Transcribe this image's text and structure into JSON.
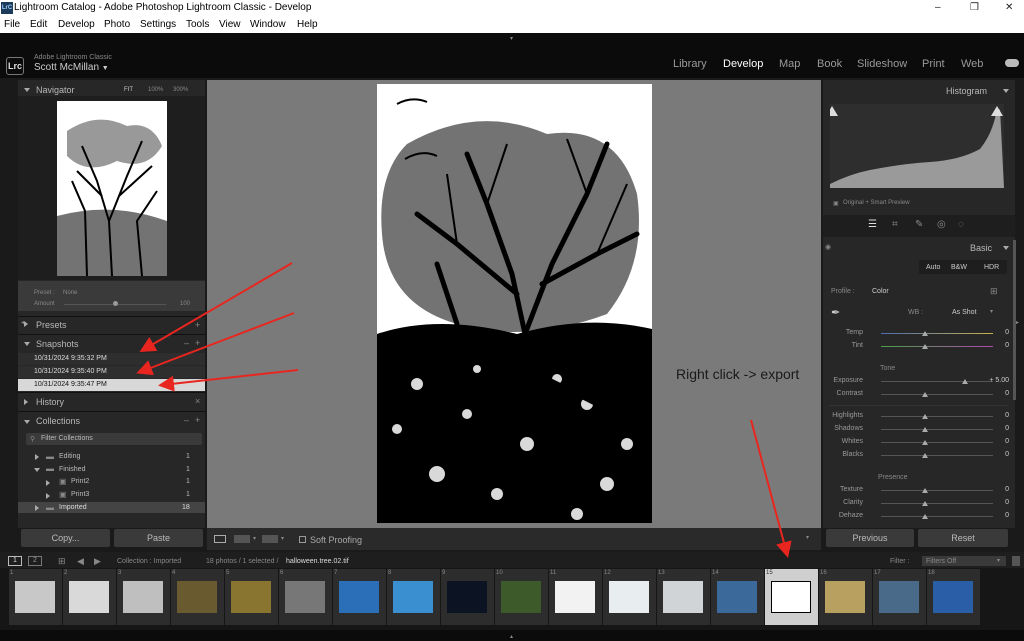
{
  "window": {
    "title": "Lightroom Catalog - Adobe Photoshop Lightroom Classic - Develop",
    "minimize": "–",
    "restore": "❐",
    "close": "✕"
  },
  "menu": [
    "File",
    "Edit",
    "Develop",
    "Photo",
    "Settings",
    "Tools",
    "View",
    "Window",
    "Help"
  ],
  "identity": {
    "badge": "Lrc",
    "product": "Adobe Lightroom Classic",
    "user": "Scott McMillan",
    "user_caret": "▼"
  },
  "modules": [
    "Library",
    "Develop",
    "Map",
    "Book",
    "Slideshow",
    "Print",
    "Web"
  ],
  "active_module": "Develop",
  "left": {
    "navigator": {
      "title": "Navigator",
      "zooms": [
        "FIT",
        "100%",
        "300%"
      ]
    },
    "preset": {
      "label": "Preset :",
      "value": "None",
      "amount_label": "Amount",
      "amount_value": "100"
    },
    "presets_title": "Presets",
    "snapshots_title": "Snapshots",
    "snapshots": [
      "10/31/2024 9:35:32 PM",
      "10/31/2024 9:35:40 PM",
      "10/31/2024 9:35:47 PM"
    ],
    "history_title": "History",
    "history_clear": "×",
    "collections_title": "Collections",
    "filter_label": "Filter Collections",
    "collections": [
      {
        "name": "Editing",
        "count": "1"
      },
      {
        "name": "Finished",
        "count": "1"
      },
      {
        "name": "Print2",
        "count": "1"
      },
      {
        "name": "Print3",
        "count": "1"
      },
      {
        "name": "Imported",
        "count": "18"
      }
    ],
    "copy_button": "Copy...",
    "paste_button": "Paste"
  },
  "toolbar": {
    "soft_proofing": "Soft Proofing"
  },
  "right": {
    "histogram_title": "Histogram",
    "preview_label": "Original + Smart Preview",
    "basic_title": "Basic",
    "tabs": [
      "Auto",
      "B&W",
      "HDR"
    ],
    "profile_label": "Profile :",
    "profile_value": "Color",
    "wb_label": "WB :",
    "wb_value": "As Shot",
    "tone_label": "Tone",
    "presence_label": "Presence",
    "sliders_wb": [
      {
        "label": "Temp",
        "value": "0"
      },
      {
        "label": "Tint",
        "value": "0"
      }
    ],
    "sliders_tone1": [
      {
        "label": "Exposure",
        "value": "+ 5.00"
      },
      {
        "label": "Contrast",
        "value": "0"
      }
    ],
    "sliders_tone2": [
      {
        "label": "Highlights",
        "value": "0"
      },
      {
        "label": "Shadows",
        "value": "0"
      },
      {
        "label": "Whites",
        "value": "0"
      },
      {
        "label": "Blacks",
        "value": "0"
      }
    ],
    "sliders_presence": [
      {
        "label": "Texture",
        "value": "0"
      },
      {
        "label": "Clarity",
        "value": "0"
      },
      {
        "label": "Dehaze",
        "value": "0"
      }
    ],
    "previous_button": "Previous",
    "reset_button": "Reset"
  },
  "filmbar": {
    "screen1": "1",
    "screen2": "2",
    "source": "Collection : Imported",
    "info": "18 photos / 1 selected /",
    "filename": "halloween.tree.02.tif",
    "filter_label": "Filter :",
    "filter_value": "Filters Off"
  },
  "film_numbers": [
    "1",
    "2",
    "3",
    "4",
    "5",
    "6",
    "7",
    "8",
    "9",
    "10",
    "11",
    "12",
    "13",
    "14",
    "15",
    "16",
    "17",
    "18"
  ],
  "annotation": "Right click -> export"
}
